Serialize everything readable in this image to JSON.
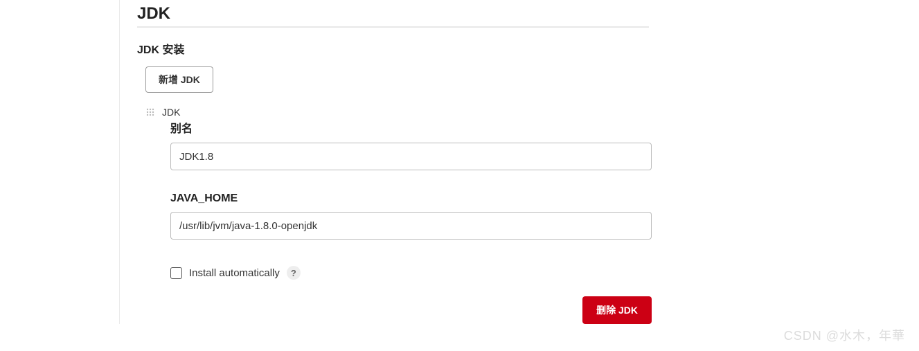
{
  "section": {
    "title": "JDK",
    "install_title": "JDK 安装",
    "add_button": "新增 JDK"
  },
  "jdk": {
    "drag_label": "JDK",
    "alias": {
      "label": "别名",
      "value": "JDK1.8"
    },
    "java_home": {
      "label": "JAVA_HOME",
      "value": "/usr/lib/jvm/java-1.8.0-openjdk"
    },
    "install_auto": {
      "label": "Install automatically",
      "checked": false
    },
    "delete_button": "删除 JDK"
  },
  "help_tooltip": "?",
  "watermark": "CSDN @水木，年華"
}
